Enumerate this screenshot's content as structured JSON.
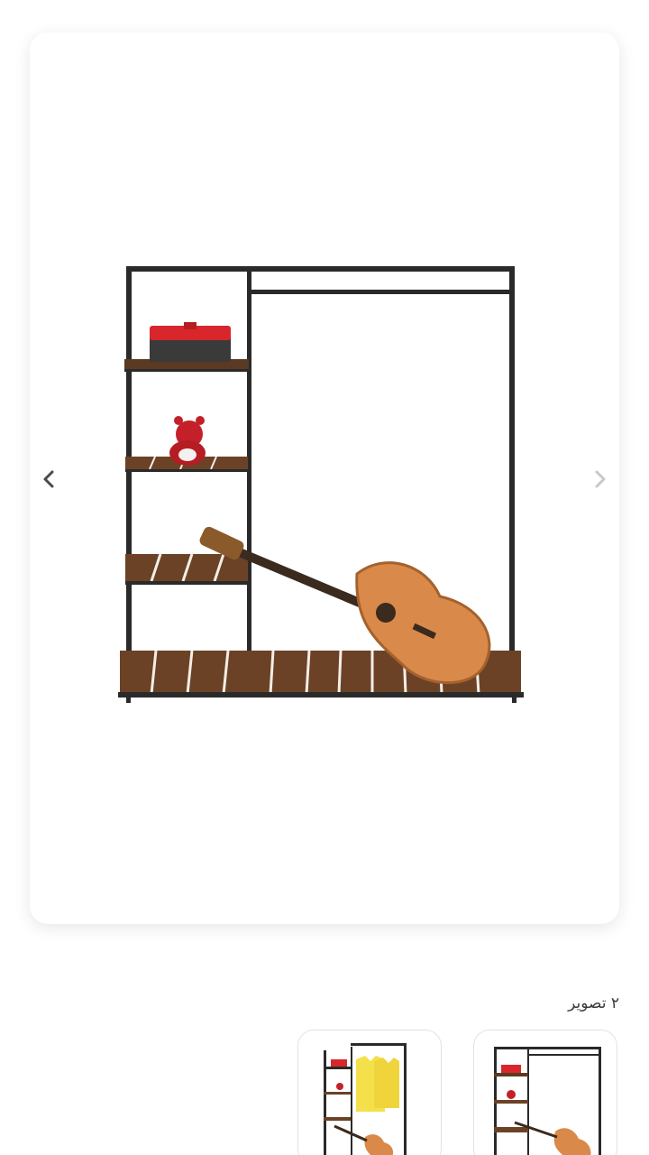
{
  "gallery": {
    "prev_icon": "chevron-left-icon",
    "next_icon": "chevron-right-icon",
    "main_image": "clothing-rack-with-shelves-and-guitar",
    "image_count_label": "۲ تصویر",
    "thumbnails": [
      {
        "image": "rack-with-guitar-thumbnail"
      },
      {
        "image": "rack-with-yellow-shirts-thumbnail"
      }
    ]
  },
  "colors": {
    "frame": "#2a2a2a",
    "wood": "#6b4226",
    "wood_light": "#8a5a36",
    "gift_box": "#d8262c",
    "guitar": "#d98a4a",
    "shirt": "#f4e04a",
    "arrow_active": "#4a4a4a",
    "arrow_inactive": "#c8c8c8"
  }
}
